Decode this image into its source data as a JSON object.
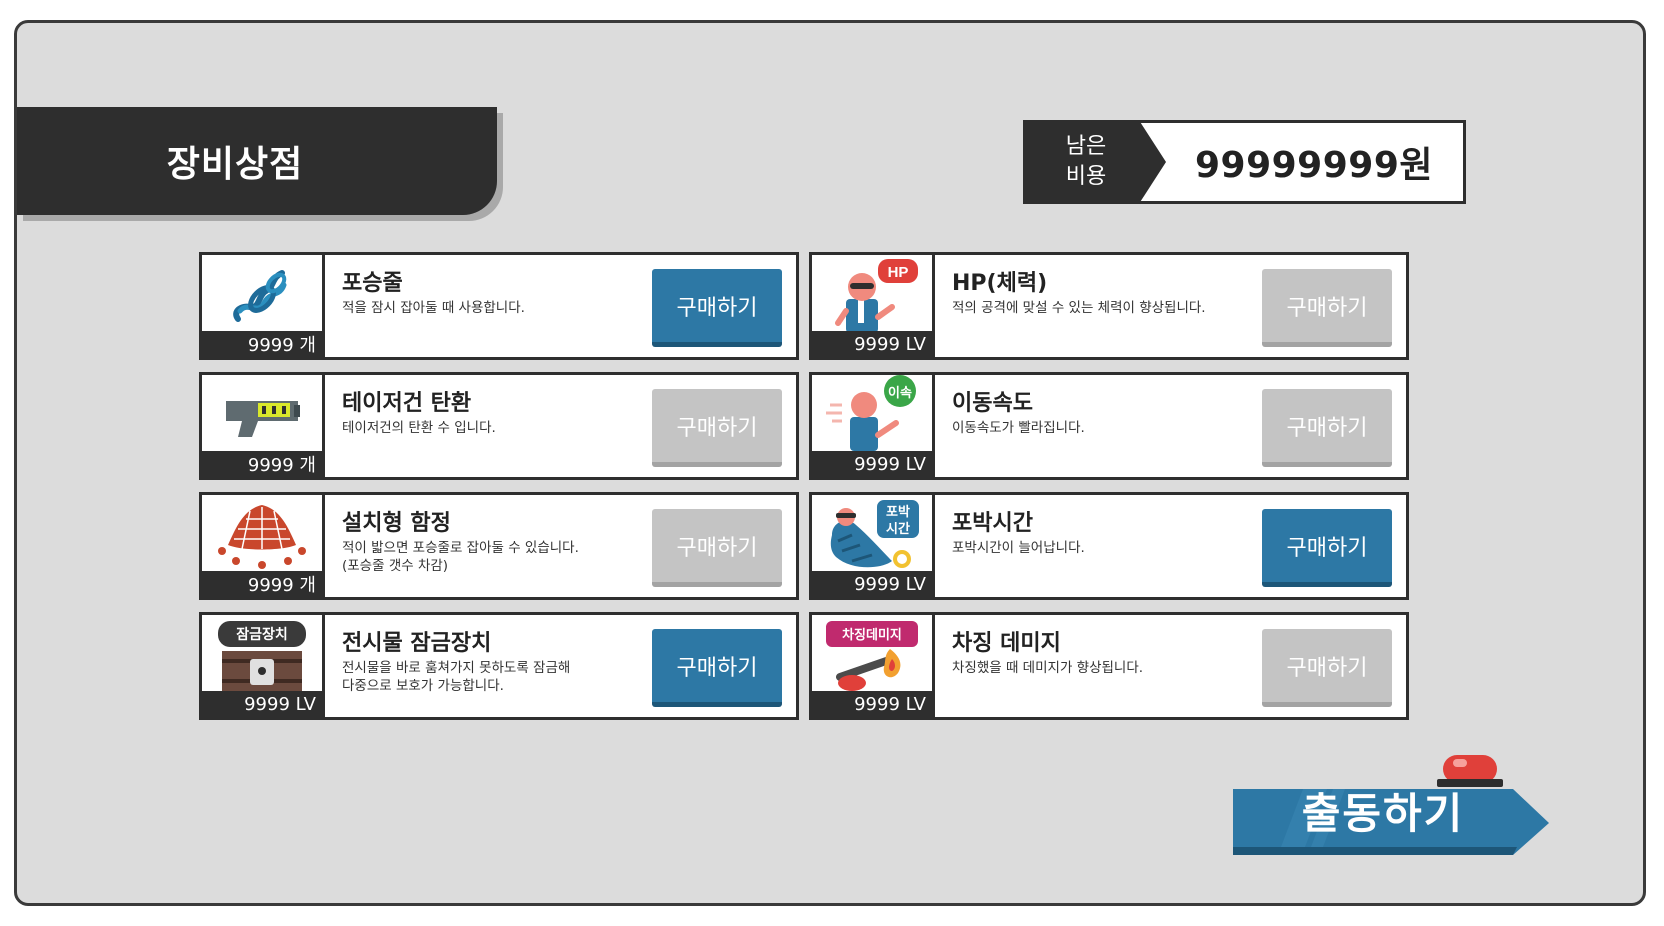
{
  "title": "장비상점",
  "budget": {
    "label_line1": "남은",
    "label_line2": "비용",
    "value": "99999999원"
  },
  "buy_label": "구매하기",
  "items": [
    {
      "name": "포승줄",
      "desc1": "적을 잠시 잡아둘 때 사용합니다.",
      "desc2": "",
      "count": "9999 개",
      "buy_enabled": true,
      "icon": "rope-icon"
    },
    {
      "name": "HP(체력)",
      "desc1": "적의 공격에 맞설 수 있는 체력이 향상됩니다.",
      "desc2": "",
      "count": "9999 LV",
      "buy_enabled": false,
      "icon": "hp-icon",
      "badge": "HP"
    },
    {
      "name": "테이저건 탄환",
      "desc1": "테이저건의 탄환 수 입니다.",
      "desc2": "",
      "count": "9999 개",
      "buy_enabled": false,
      "icon": "taser-icon"
    },
    {
      "name": "이동속도",
      "desc1": "이동속도가 빨라집니다.",
      "desc2": "",
      "count": "9999 LV",
      "buy_enabled": false,
      "icon": "speed-icon",
      "badge": "이속"
    },
    {
      "name": "설치형 함정",
      "desc1": "적이 밟으면 포승줄로 잡아둘 수 있습니다.",
      "desc2": "(포승줄 갯수 차감)",
      "count": "9999 개",
      "buy_enabled": false,
      "icon": "net-trap-icon"
    },
    {
      "name": "포박시간",
      "desc1": "포박시간이 늘어납니다.",
      "desc2": "",
      "count": "9999 LV",
      "buy_enabled": true,
      "icon": "bind-time-icon",
      "badge": "포박\n시간"
    },
    {
      "name": "전시물 잠금장치",
      "desc1": "전시물을 바로 훔쳐가지 못하도록 잠금해",
      "desc2": "다중으로 보호가 가능합니다.",
      "count": "9999 LV",
      "buy_enabled": true,
      "icon": "lock-device-icon",
      "badge": "잠금장치"
    },
    {
      "name": "차징 데미지",
      "desc1": "차징했을 때 데미지가 향상됩니다.",
      "desc2": "",
      "count": "9999 LV",
      "buy_enabled": false,
      "icon": "charge-damage-icon",
      "badge": "차징데미지"
    }
  ],
  "deploy_button": "출동하기",
  "colors": {
    "primary": "#2d78a5",
    "disabled": "#c4c4c4",
    "dark": "#2e2e2e",
    "background": "#dcdcdc",
    "alarm": "#e0403a"
  }
}
